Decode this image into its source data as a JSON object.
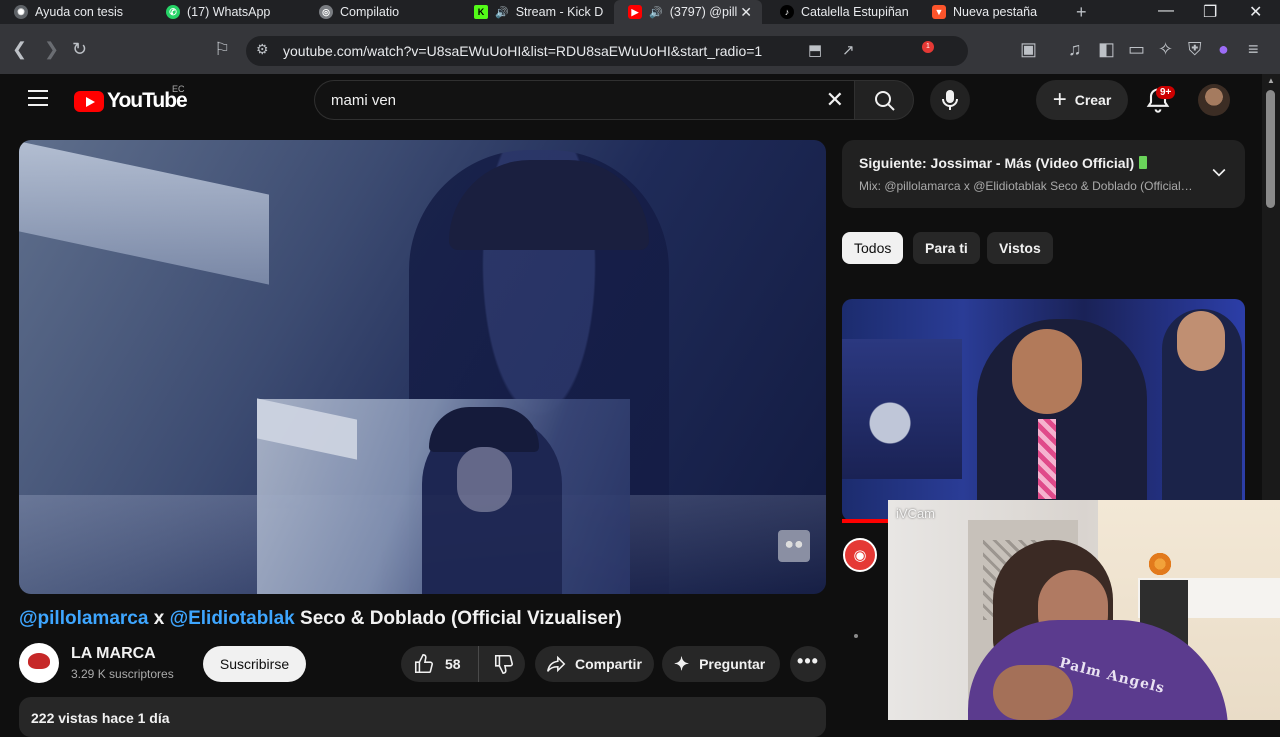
{
  "browser": {
    "tabs": [
      {
        "title": "Ayuda con tesis",
        "favicon": "openai-icon",
        "active": false
      },
      {
        "title": "(17) WhatsApp",
        "favicon": "whatsapp-icon",
        "active": false
      },
      {
        "title": "Compilatio",
        "favicon": "globe-icon",
        "active": false
      },
      {
        "title": "Stream - Kick D",
        "favicon": "kick-icon",
        "active": false,
        "audio": true
      },
      {
        "title": "(3797) @pill",
        "favicon": "youtube-icon",
        "active": true,
        "audio": true
      },
      {
        "title": "Catalella Estupiñan",
        "favicon": "tiktok-icon",
        "active": false
      },
      {
        "title": "Nueva pestaña",
        "favicon": "brave-icon",
        "active": false
      }
    ],
    "new_tab_symbol": "+",
    "address": "youtube.com/watch?v=U8saEWuUoHI&list=RDU8saEWuUoHI&start_radio=1",
    "brave_badge": "1",
    "colors": {
      "chrome_bg": "#202124",
      "toolbar_bg": "#35363a"
    }
  },
  "masthead": {
    "logo_text": "YouTube",
    "region": "EC",
    "search_query": "mami ven",
    "create_label": "Crear",
    "notifications_badge": "9+"
  },
  "video": {
    "title_mention_1": "@pillolamarca",
    "title_separator": "x",
    "title_mention_2": "@Elidiotablak",
    "title_rest": "Seco & Doblado (Official Vizualiser)",
    "channel_name": "LA MARCA",
    "subscribers": "3.29 K suscriptores",
    "subscribe_label": "Suscribirse",
    "likes": "58",
    "share_label": "Compartir",
    "ask_label": "Preguntar",
    "more_label": "•••",
    "description_meta": "222 vistas  hace 1 día"
  },
  "up_next": {
    "label": "Siguiente: Jossimar - Más (Video Official)",
    "mix": "Mix: @pillolamarca x @Elidiotablak Seco & Doblado (Official Vizualiser)"
  },
  "chips": [
    "Todos",
    "Para ti",
    "Vistos"
  ],
  "webcam": {
    "label": "iVCam",
    "hoodie_text": "Palm Angels"
  },
  "colors": {
    "accent": "#ff0000",
    "link": "#3ea6ff",
    "page_bg": "#0f0f0f",
    "surface": "#272727"
  }
}
